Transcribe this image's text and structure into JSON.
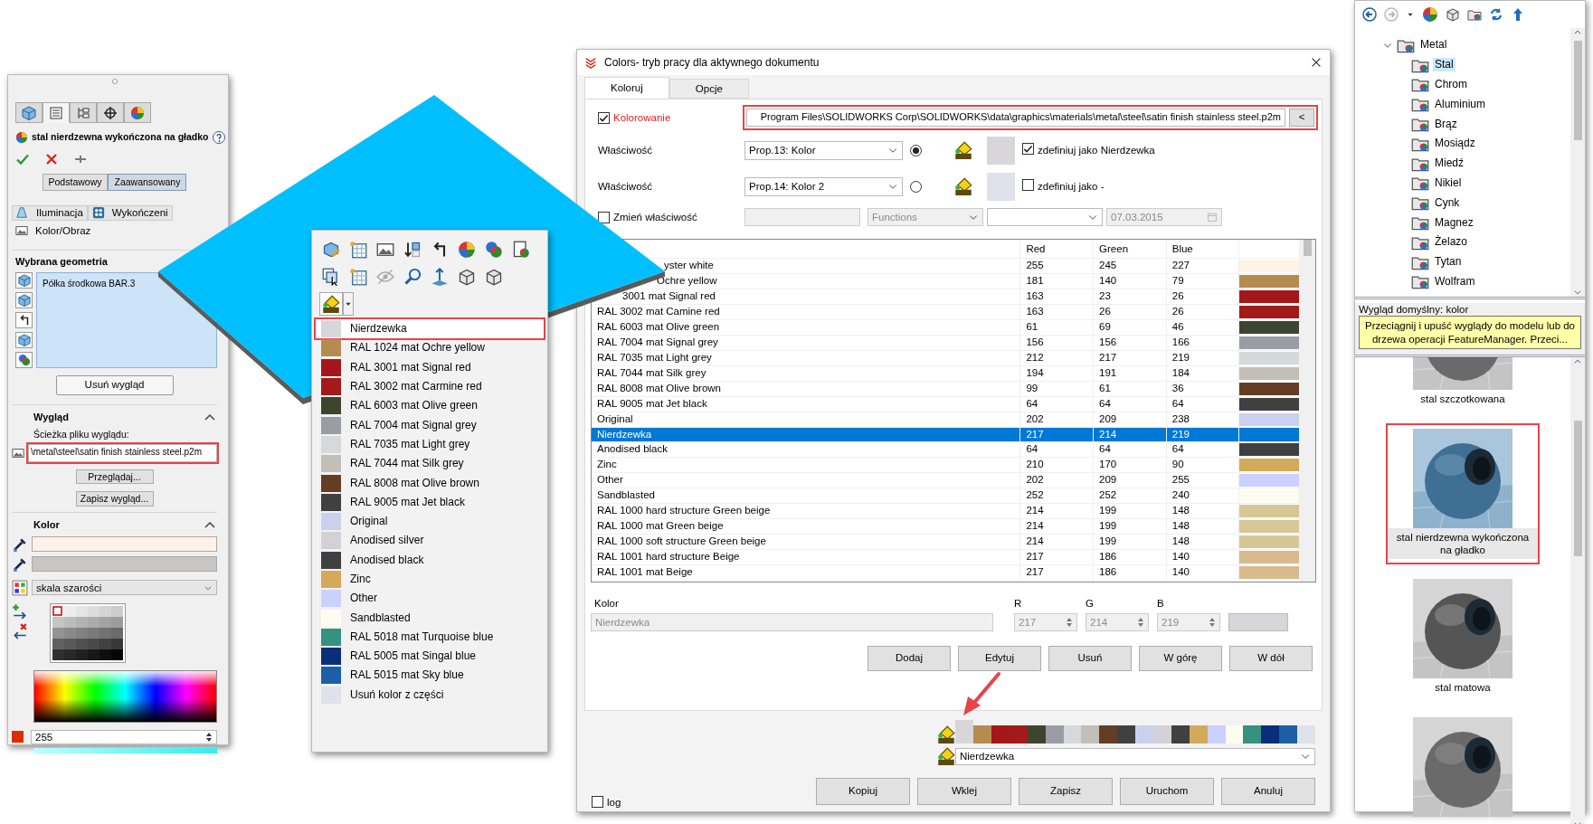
{
  "feature_panel": {
    "tabs": [
      {
        "selected": false
      },
      {
        "selected": true
      },
      {
        "selected": false
      },
      {
        "selected": false
      },
      {
        "selected": false
      }
    ],
    "title": "stal nierdzewna wykończona na gładko",
    "mode_buttons": [
      {
        "label": "Podstawowy",
        "selected": false
      },
      {
        "label": "Zaawansowany",
        "selected": true
      }
    ],
    "sections": [
      "Iluminacja",
      "Wykończeni"
    ],
    "subsection": "Kolor/Obraz",
    "geometry": {
      "heading": "Wybrana geometria",
      "items": [
        "Półka środkowa BAR.3"
      ],
      "remove_button": "Usuń wygląd"
    },
    "appearance": {
      "heading": "Wygląd",
      "path_label": "Ścieżka pliku wyglądu:",
      "path": "\\metal\\steel\\satin finish stainless steel.p2m",
      "highlighted": true,
      "browse_button": "Przeglądaj...",
      "save_button": "Zapisz wygląd..."
    },
    "color": {
      "heading": "Kolor",
      "fields": [
        {
          "color": "#fdf1ea"
        },
        {
          "color": "#c9c5c2"
        }
      ],
      "palette": "skala szarości",
      "swatch": {
        "color": "#dd2c00"
      },
      "value": "255",
      "level": 1
    }
  },
  "context_menu": {
    "items": [
      {
        "label": "Nierdzewka",
        "color": "#d9d6db",
        "selected": true,
        "highlighted": true
      },
      {
        "label": "RAL 1024 mat Ochre yellow",
        "color": "#b58c4f",
        "selected": false,
        "highlighted": false
      },
      {
        "label": "RAL 3001 mat Signal red",
        "color": "#a3171a",
        "selected": false,
        "highlighted": false
      },
      {
        "label": "RAL 3002 mat Carmine red",
        "color": "#a31a1a",
        "selected": false,
        "highlighted": false
      },
      {
        "label": "RAL 6003 mat Olive green",
        "color": "#3d452e",
        "selected": false,
        "highlighted": false
      },
      {
        "label": "RAL 7004 mat Signal grey",
        "color": "#9c9ca6",
        "selected": false,
        "highlighted": false
      },
      {
        "label": "RAL 7035 mat Light grey",
        "color": "#d4d9db",
        "selected": false,
        "highlighted": false
      },
      {
        "label": "RAL 7044 mat Silk grey",
        "color": "#c2bfb8",
        "selected": false,
        "highlighted": false
      },
      {
        "label": "RAL 8008 mat Olive brown",
        "color": "#633d24",
        "selected": false,
        "highlighted": false
      },
      {
        "label": "RAL 9005 mat Jet black",
        "color": "#404040",
        "selected": false,
        "highlighted": false
      },
      {
        "label": "Original",
        "color": "#cad1ee",
        "selected": false,
        "highlighted": false
      },
      {
        "label": "Anodised silver",
        "color": "#d3d1d8",
        "selected": false,
        "highlighted": false
      },
      {
        "label": "Anodised black",
        "color": "#404041",
        "selected": false,
        "highlighted": false
      },
      {
        "label": "Zinc",
        "color": "#d2aa5a",
        "selected": false,
        "highlighted": false
      },
      {
        "label": "Other",
        "color": "#cad1ff",
        "selected": false,
        "highlighted": false
      },
      {
        "label": "Sandblasted",
        "color": "#fcfcf0",
        "selected": false,
        "highlighted": false
      },
      {
        "label": "RAL 5018 mat Turquoise blue",
        "color": "#36917f",
        "selected": false,
        "highlighted": false
      },
      {
        "label": "RAL 5005 mat Singal blue",
        "color": "#0a2e7a",
        "selected": false,
        "highlighted": false
      },
      {
        "label": "RAL 5015 mat Sky blue",
        "color": "#1a5fa8",
        "selected": false,
        "highlighted": false
      },
      {
        "label": "Usuń kolor z części",
        "color": "#dfe2ea",
        "selected": false,
        "highlighted": false
      }
    ]
  },
  "dialog": {
    "title": "Colors- tryb pracy dla aktywnego dokumentu",
    "tabs": [
      {
        "label": "Koloruj",
        "selected": true
      },
      {
        "label": "Opcje",
        "selected": false
      }
    ],
    "coloring": {
      "label": "Kolorowanie",
      "checked": true
    },
    "path": "Program Files\\SOLIDWORKS Corp\\SOLIDWORKS\\data\\graphics\\materials\\metal\\steel\\satin finish stainless steel.p2m",
    "path_highlighted": true,
    "collapse_button": "<",
    "properties": [
      {
        "label": "Właściwość",
        "value": "Prop.13: Kolor",
        "selected": true,
        "color": "#d9d6db",
        "define_checked": true,
        "define_label": "zdefiniuj jako Nierdzewka"
      },
      {
        "label": "Właściwość",
        "value": "Prop.14: Kolor 2",
        "selected": false,
        "color": "#dfe2ea",
        "define_checked": false,
        "define_label": "zdefiniuj jako  -"
      }
    ],
    "change_property": {
      "label": "Zmień właściwość",
      "checked": false
    },
    "functions": "Functions",
    "date": "07.03.2015",
    "table": {
      "columns": [
        "Red",
        "Green",
        "Blue"
      ],
      "rows": [
        {
          "name": "yster white",
          "red": "255",
          "green": "245",
          "blue": "227",
          "color": "#fff3e3",
          "selected": false
        },
        {
          "name": "Ochre yellow",
          "red": "181",
          "green": "140",
          "blue": "79",
          "color": "#b58c4f",
          "selected": false
        },
        {
          "name": "3001 mat Signal red",
          "red": "163",
          "green": "23",
          "blue": "26",
          "color": "#a3171a",
          "selected": false
        },
        {
          "name": "RAL 3002 mat Camine red",
          "red": "163",
          "green": "26",
          "blue": "26",
          "color": "#a31a1a",
          "selected": false
        },
        {
          "name": "RAL 6003 mat Olive green",
          "red": "61",
          "green": "69",
          "blue": "46",
          "color": "#3d452e",
          "selected": false
        },
        {
          "name": "RAL 7004 mat Signal grey",
          "red": "156",
          "green": "156",
          "blue": "166",
          "color": "#9c9ca6",
          "selected": false
        },
        {
          "name": "RAL 7035 mat Light grey",
          "red": "212",
          "green": "217",
          "blue": "219",
          "color": "#d4d9db",
          "selected": false
        },
        {
          "name": "RAL 7044 mat Silk grey",
          "red": "194",
          "green": "191",
          "blue": "184",
          "color": "#c2bfb8",
          "selected": false
        },
        {
          "name": "RAL 8008 mat Olive brown",
          "red": "99",
          "green": "61",
          "blue": "36",
          "color": "#633d24",
          "selected": false
        },
        {
          "name": "RAL 9005 mat Jet black",
          "red": "64",
          "green": "64",
          "blue": "64",
          "color": "#404040",
          "selected": false
        },
        {
          "name": "Original",
          "red": "202",
          "green": "209",
          "blue": "238",
          "color": "#cad1ee",
          "selected": false
        },
        {
          "name": "Nierdzewka",
          "red": "217",
          "green": "214",
          "blue": "219",
          "selected": true
        },
        {
          "name": "Anodised black",
          "red": "64",
          "green": "64",
          "blue": "64",
          "color": "#404041",
          "selected": false
        },
        {
          "name": "Zinc",
          "red": "210",
          "green": "170",
          "blue": "90",
          "color": "#d2aa5a",
          "selected": false
        },
        {
          "name": "Other",
          "red": "202",
          "green": "209",
          "blue": "255",
          "color": "#cad1ff",
          "selected": false
        },
        {
          "name": "Sandblasted",
          "red": "252",
          "green": "252",
          "blue": "240",
          "color": "#fcfcf0",
          "selected": false
        },
        {
          "name": "RAL 1000 hard structure Green beige",
          "red": "214",
          "green": "199",
          "blue": "148",
          "color": "#d6c794",
          "selected": false
        },
        {
          "name": "RAL 1000 mat Green beige",
          "red": "214",
          "green": "199",
          "blue": "148",
          "color": "#d6c795",
          "selected": false
        },
        {
          "name": "RAL 1000 soft structure Green beige",
          "red": "214",
          "green": "199",
          "blue": "148",
          "color": "#d6c796",
          "selected": false
        },
        {
          "name": "RAL 1001 hard structure Beige",
          "red": "217",
          "green": "186",
          "blue": "140",
          "color": "#d9ba8c",
          "selected": false
        },
        {
          "name": "RAL 1001 mat Beige",
          "red": "217",
          "green": "186",
          "blue": "140",
          "color": "#d9ba8d",
          "selected": false
        }
      ]
    },
    "color_label": "Kolor",
    "color_name": "Nierdzewka",
    "rgb": [
      {
        "label": "R",
        "value": "217"
      },
      {
        "label": "G",
        "value": "214"
      },
      {
        "label": "B",
        "value": "219"
      }
    ],
    "preview": {
      "color": "#d9d6db"
    },
    "buttons": [
      "Dodaj",
      "Edytuj",
      "Usuń",
      "W górę",
      "W dół"
    ],
    "palette": [
      {
        "color": "#d9d6db",
        "selected": true
      },
      {
        "color": "#b58c4f",
        "selected": false
      },
      {
        "color": "#a3171a",
        "selected": false
      },
      {
        "color": "#a31a1a",
        "selected": false
      },
      {
        "color": "#3d452e",
        "selected": false
      },
      {
        "color": "#9c9ca6",
        "selected": false
      },
      {
        "color": "#d4d9db",
        "selected": false
      },
      {
        "color": "#c2bfb8",
        "selected": false
      },
      {
        "color": "#633d24",
        "selected": false
      },
      {
        "color": "#404040",
        "selected": false
      },
      {
        "color": "#cad1ee",
        "selected": false
      },
      {
        "color": "#d3d1d8",
        "selected": false
      },
      {
        "color": "#404041",
        "selected": false
      },
      {
        "color": "#d2aa5a",
        "selected": false
      },
      {
        "color": "#cad1ff",
        "selected": false
      },
      {
        "color": "#fcfcf0",
        "selected": false
      },
      {
        "color": "#36917f",
        "selected": false
      },
      {
        "color": "#0a2e7a",
        "selected": false
      },
      {
        "color": "#1a5fa8",
        "selected": false
      },
      {
        "color": "#dfe2ea",
        "selected": false
      }
    ],
    "selected_color": "Nierdzewka",
    "log": {
      "label": "log",
      "checked": false
    },
    "footer_buttons": [
      "Kopiuj",
      "Wklej",
      "Zapisz",
      "Uruchom",
      "Anuluj"
    ]
  },
  "library": {
    "tree": [
      {
        "label": "Metal",
        "expanded": true,
        "children": [
          {
            "label": "Stal",
            "selected": true
          },
          {
            "label": "Chrom",
            "selected": false
          },
          {
            "label": "Aluminium",
            "selected": false
          },
          {
            "label": "Brąz",
            "selected": false
          },
          {
            "label": "Mosiądz",
            "selected": false
          },
          {
            "label": "Miedź",
            "selected": false
          },
          {
            "label": "Nikiel",
            "selected": false
          },
          {
            "label": "Cynk",
            "selected": false
          },
          {
            "label": "Magnez",
            "selected": false
          },
          {
            "label": "Żelazo",
            "selected": false
          },
          {
            "label": "Tytan",
            "selected": false
          },
          {
            "label": "Wolfram",
            "selected": false
          }
        ]
      }
    ],
    "default_label": "Wygląd domyślny: kolor",
    "tooltip": "Przeciągnij i upuść wyglądy do modelu lub do drzewa operacji FeatureManager. Przeci...",
    "tiles": [
      {
        "label": "stal szczotkowana",
        "selected": false,
        "highlighted": false
      },
      {
        "label": "stal nierdzewna wykończona na gładko",
        "selected": true,
        "highlighted": true
      },
      {
        "label": "stal matowa",
        "selected": false,
        "highlighted": false
      },
      {
        "selected": false,
        "highlighted": false
      }
    ]
  }
}
